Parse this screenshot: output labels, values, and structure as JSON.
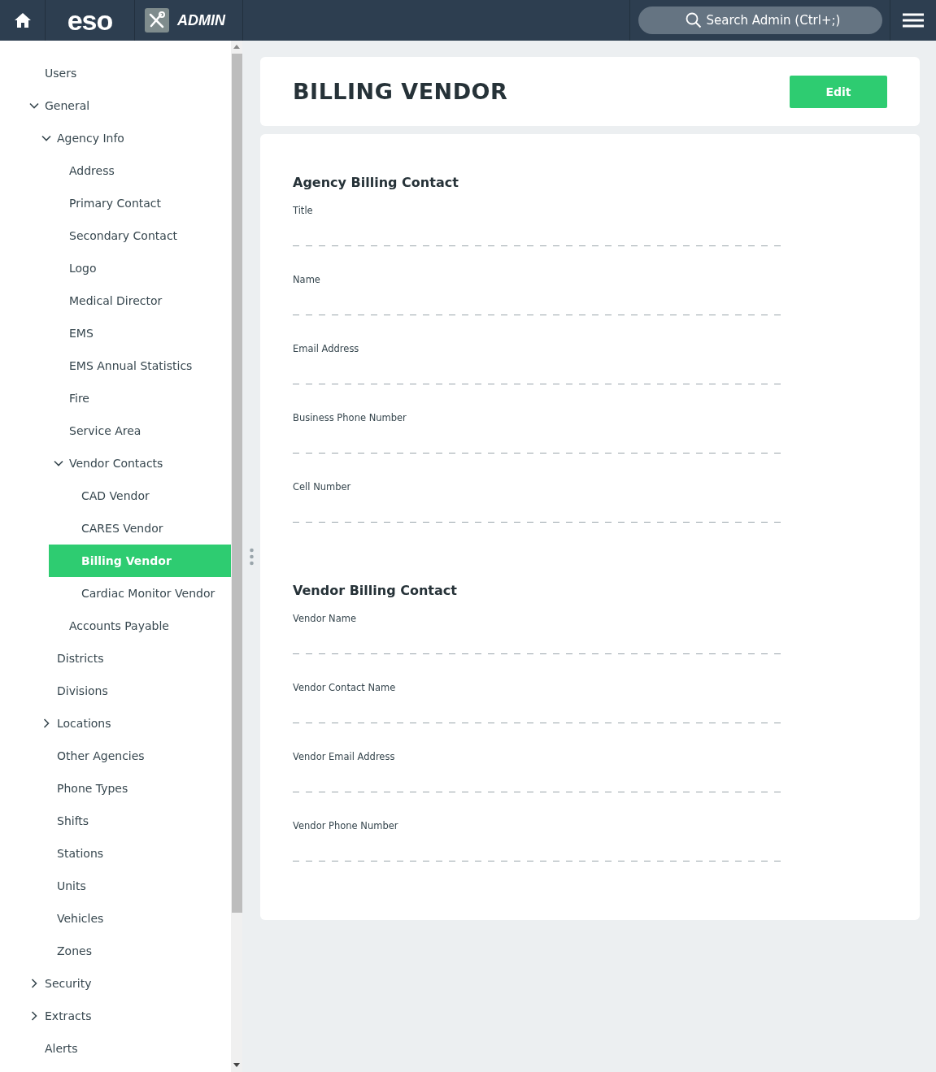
{
  "header": {
    "logo": "eso",
    "app_title": "ADMIN",
    "search": {
      "placeholder": "Search Admin (Ctrl+;)"
    }
  },
  "sidebar": {
    "items": [
      {
        "label": "Users",
        "selected": false
      },
      {
        "label": "General",
        "selected": false,
        "expanded": true,
        "children": [
          {
            "label": "Agency Info",
            "selected": false,
            "expanded": true,
            "children": [
              {
                "label": "Address",
                "selected": false
              },
              {
                "label": "Primary Contact",
                "selected": false
              },
              {
                "label": "Secondary Contact",
                "selected": false
              },
              {
                "label": "Logo",
                "selected": false
              },
              {
                "label": "Medical Director",
                "selected": false
              },
              {
                "label": "EMS",
                "selected": false
              },
              {
                "label": "EMS Annual Statistics",
                "selected": false
              },
              {
                "label": "Fire",
                "selected": false
              },
              {
                "label": "Service Area",
                "selected": false
              },
              {
                "label": "Vendor Contacts",
                "selected": false,
                "expanded": true,
                "children": [
                  {
                    "label": "CAD Vendor",
                    "selected": false
                  },
                  {
                    "label": "CARES Vendor",
                    "selected": false
                  },
                  {
                    "label": "Billing Vendor",
                    "selected": true
                  },
                  {
                    "label": "Cardiac Monitor Vendor",
                    "selected": false
                  }
                ]
              },
              {
                "label": "Accounts Payable",
                "selected": false
              }
            ]
          },
          {
            "label": "Districts",
            "selected": false
          },
          {
            "label": "Divisions",
            "selected": false
          },
          {
            "label": "Locations",
            "selected": false,
            "expanded": false
          },
          {
            "label": "Other Agencies",
            "selected": false
          },
          {
            "label": "Phone Types",
            "selected": false
          },
          {
            "label": "Shifts",
            "selected": false
          },
          {
            "label": "Stations",
            "selected": false
          },
          {
            "label": "Units",
            "selected": false
          },
          {
            "label": "Vehicles",
            "selected": false
          },
          {
            "label": "Zones",
            "selected": false
          }
        ]
      },
      {
        "label": "Security",
        "selected": false,
        "expanded": false
      },
      {
        "label": "Extracts",
        "selected": false,
        "expanded": false
      },
      {
        "label": "Alerts",
        "selected": false
      }
    ]
  },
  "page": {
    "title": "BILLING VENDOR",
    "edit_button": "Edit",
    "sections": [
      {
        "heading": "Agency Billing Contact",
        "fields": [
          {
            "label": "Title"
          },
          {
            "label": "Name"
          },
          {
            "label": "Email Address"
          },
          {
            "label": "Business Phone Number"
          },
          {
            "label": "Cell Number"
          }
        ]
      },
      {
        "heading": "Vendor Billing Contact",
        "fields": [
          {
            "label": "Vendor Name"
          },
          {
            "label": "Vendor Contact Name"
          },
          {
            "label": "Vendor Email Address"
          },
          {
            "label": "Vendor Phone Number"
          }
        ]
      }
    ]
  }
}
